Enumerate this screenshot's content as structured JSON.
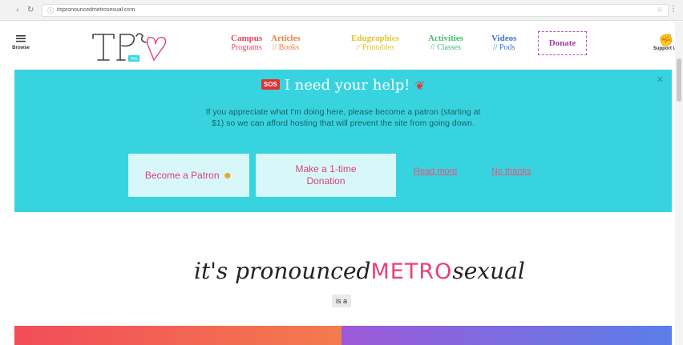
{
  "browser": {
    "url": "itspronouncedmetrosexual.com"
  },
  "header": {
    "browse_label": "Browse",
    "support_label": "Support Us",
    "donate_label": "Donate",
    "logo_badge": "TAG",
    "nav": [
      {
        "title": "Campus",
        "subtitle": "Programs",
        "color": "#e8455d"
      },
      {
        "title": "Articles",
        "subtitle": "// Books",
        "color": "#f47c3c"
      },
      {
        "title": "Edugraphics",
        "subtitle": "// Printables",
        "color": "#e9c22b"
      },
      {
        "title": "Activities",
        "subtitle": "// Classes",
        "color": "#3bbf6b"
      },
      {
        "title": "Videos",
        "subtitle": "// Pods",
        "color": "#3e73d8"
      }
    ]
  },
  "banner": {
    "badge": "SOS",
    "title": "I need your help!",
    "body": "If you appreciate what I'm doing here, please become a patron (starting at $1) so we can afford hosting that will prevent the site from going down.",
    "patron_button": "Become a Patron",
    "donation_button": "Make a 1-time Donation",
    "read_more": "Read more",
    "no_thanks": "No thanks",
    "accent": "#37d4e0"
  },
  "tagline": {
    "pre": "it's pronounced",
    "metro": "METRO",
    "post": "sexual",
    "is_a": "is a"
  }
}
